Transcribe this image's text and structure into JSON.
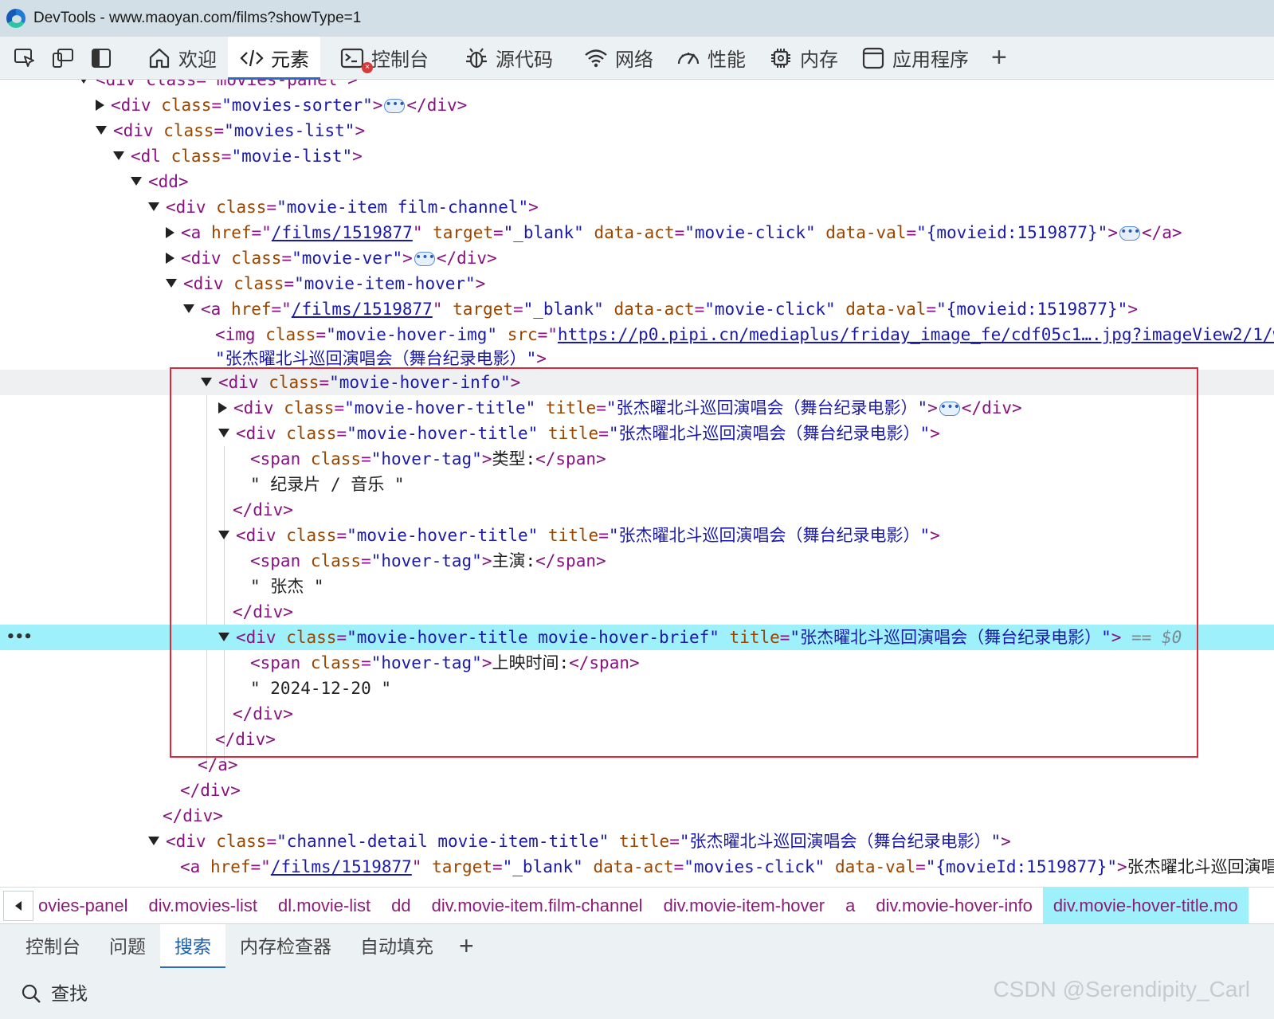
{
  "window": {
    "title": "DevTools - www.maoyan.com/films?showType=1"
  },
  "toolbar": {
    "tabs": [
      {
        "label": "欢迎",
        "icon": "home-icon"
      },
      {
        "label": "元素",
        "icon": "code-icon"
      },
      {
        "label": "控制台",
        "icon": "console-icon"
      },
      {
        "label": "源代码",
        "icon": "bug-icon"
      },
      {
        "label": "网络",
        "icon": "wifi-icon"
      },
      {
        "label": "性能",
        "icon": "gauge-icon"
      },
      {
        "label": "内存",
        "icon": "chip-icon"
      },
      {
        "label": "应用程序",
        "icon": "app-window-icon"
      }
    ],
    "console_error_badge": "×"
  },
  "dom": {
    "l0": "<div class=\"movies-panel\">",
    "sorter": {
      "open": "<div ",
      "attr": "class",
      "val": "\"movies-sorter\"",
      "close": "</div>"
    },
    "list": {
      "attr": "class",
      "val": "\"movies-list\""
    },
    "dl": {
      "attr": "class",
      "val": "\"movie-list\""
    },
    "dd": "<dd>",
    "item": {
      "attr": "class",
      "val": "\"movie-item film-channel\""
    },
    "a1": {
      "href": "/films/1519877",
      "target": "\"_blank\"",
      "act": "\"movie-click\"",
      "dataval": "\"{movieid:1519877}\""
    },
    "ver": {
      "val": "\"movie-ver\""
    },
    "hover": {
      "val": "\"movie-item-hover\""
    },
    "a2": {
      "href": "/films/1519877",
      "target": "\"_blank\"",
      "act": "\"movie-click\"",
      "dataval": "\"{movieid:1519877}\""
    },
    "img": {
      "val": "\"movie-hover-img\"",
      "src": "https://p0.pipi.cn/mediaplus/friday_image_fe/cdf05c1….jpg?imageView2/1/w/",
      "alt": "\"张杰曜北斗巡回演唱会（舞台纪录电影）\""
    },
    "info": {
      "val": "\"movie-hover-info\""
    },
    "t1": {
      "val": "\"movie-hover-title\"",
      "title": "\"张杰曜北斗巡回演唱会（舞台纪录电影）\""
    },
    "t2": {
      "val": "\"movie-hover-title\"",
      "title": "\"张杰曜北斗巡回演唱会（舞台纪录电影）\"",
      "tag": "\"hover-tag\"",
      "label": "类型:",
      "text": "\" 纪录片 / 音乐 \""
    },
    "t3": {
      "val": "\"movie-hover-title\"",
      "title": "\"张杰曜北斗巡回演唱会（舞台纪录电影）\"",
      "tag": "\"hover-tag\"",
      "label": "主演:",
      "text": "\" 张杰 \""
    },
    "t4": {
      "val": "\"movie-hover-title movie-hover-brief\"",
      "title": "\"张杰曜北斗巡回演唱会（舞台纪录电影）\"",
      "tag": "\"hover-tag\"",
      "label": "上映时间:",
      "text": "\" 2024-12-20 \"",
      "sel": "== $0"
    },
    "detail": {
      "val": "\"channel-detail movie-item-title\"",
      "title": "\"张杰曜北斗巡回演唱会（舞台纪录电影）\""
    },
    "a3": {
      "href": "/films/1519877",
      "target": "\"_blank\"",
      "act": "\"movies-click\"",
      "dataval": "\"{movieId:1519877}\"",
      "text": "张杰曜北斗巡回演唱"
    }
  },
  "breadcrumb": [
    "ovies-panel",
    "div.movies-list",
    "dl.movie-list",
    "dd",
    "div.movie-item.film-channel",
    "div.movie-item-hover",
    "a",
    "div.movie-hover-info",
    "div.movie-hover-title.mo"
  ],
  "drawer": {
    "tabs": [
      "控制台",
      "问题",
      "搜索",
      "内存检查器",
      "自动填充"
    ],
    "search_placeholder": "查找"
  },
  "watermark": "CSDN @Serendipity_Carl"
}
